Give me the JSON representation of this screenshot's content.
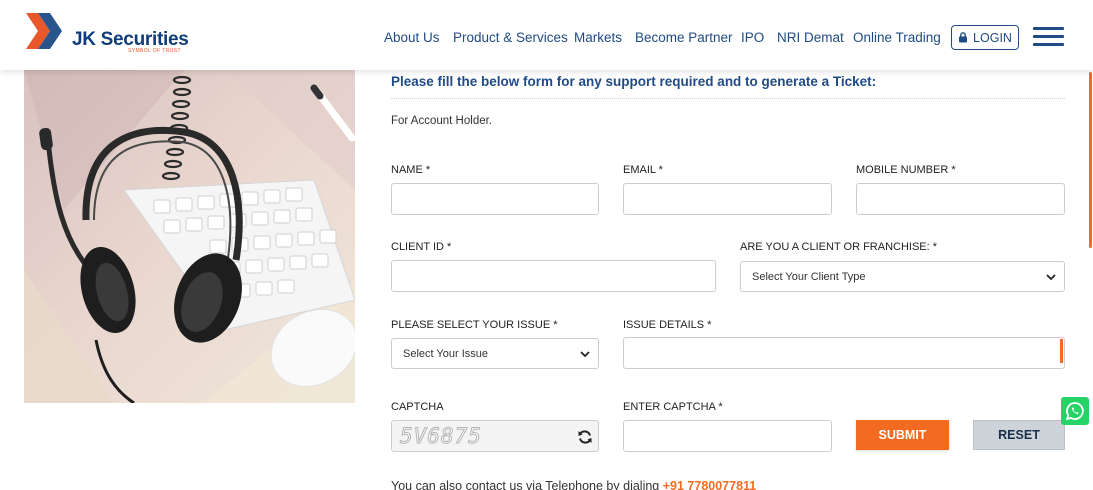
{
  "brand": {
    "name": "JK Securities",
    "tagline": "SYMBOL OF TRUST",
    "colors": {
      "primary": "#1f4b86",
      "accent": "#f26b21",
      "whatsapp": "#25d366"
    }
  },
  "nav": {
    "items": [
      {
        "label": "About Us"
      },
      {
        "label": "Product & Services"
      },
      {
        "label": "Markets"
      },
      {
        "label": "Become Partner"
      },
      {
        "label": "IPO"
      },
      {
        "label": "NRI Demat"
      },
      {
        "label": "Online Trading"
      }
    ],
    "login_label": "LOGIN",
    "login_icon": "lock-icon",
    "menu_icon": "hamburger-menu-icon"
  },
  "hero": {
    "image": "headphones-on-keyboard-photo"
  },
  "form": {
    "title": "Please fill the below form for any support required and to generate a Ticket:",
    "subtitle": "For Account Holder.",
    "fields": {
      "name": {
        "label": "NAME *",
        "value": ""
      },
      "email": {
        "label": "EMAIL *",
        "value": ""
      },
      "mobile": {
        "label": "MOBILE NUMBER *",
        "value": ""
      },
      "client_id": {
        "label": "CLIENT ID *",
        "value": ""
      },
      "client_type": {
        "label": "ARE YOU A CLIENT OR FRANCHISE: *",
        "selected": "Select Your Client Type"
      },
      "issue": {
        "label": "PLEASE SELECT YOUR ISSUE *",
        "selected": "Select Your Issue"
      },
      "issue_details": {
        "label": "ISSUE DETAILS *",
        "value": ""
      },
      "captcha": {
        "label": "CAPTCHA",
        "code": "5V6875",
        "refresh_icon": "refresh-icon"
      },
      "enter_captcha": {
        "label": "ENTER CAPTCHA *",
        "value": ""
      }
    },
    "submit_label": "SUBMIT",
    "reset_label": "RESET"
  },
  "contact": {
    "text": "You can also contact us via Telephone by dialing",
    "phone": "+91 7780077811"
  },
  "floating": {
    "whatsapp_icon": "whatsapp-icon"
  }
}
